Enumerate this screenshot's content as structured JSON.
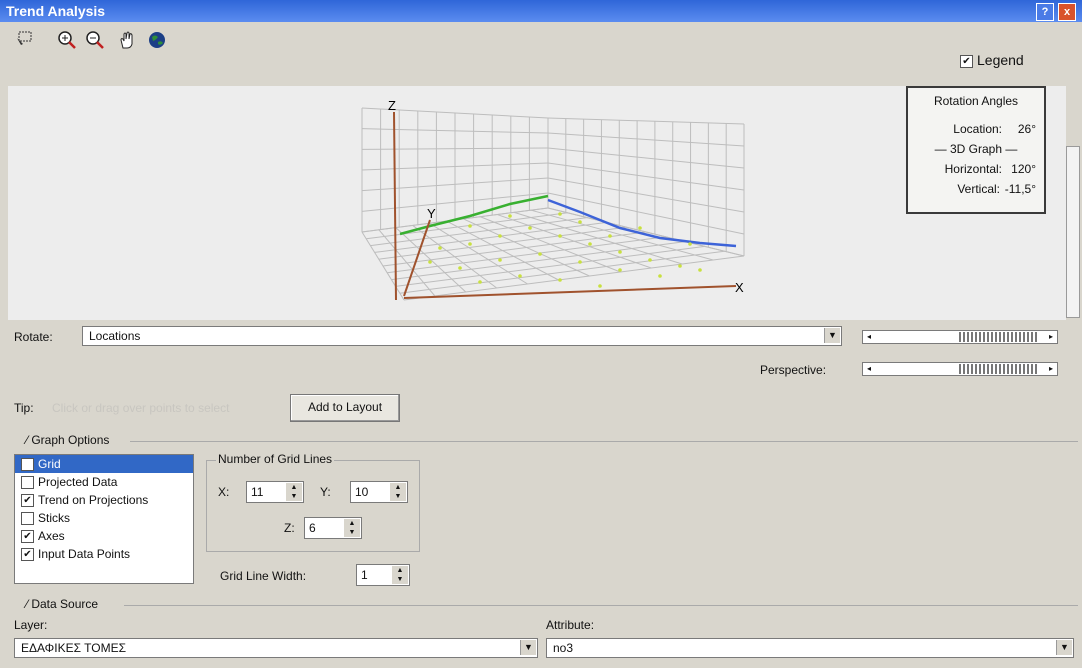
{
  "window": {
    "title": "Trend Analysis",
    "help": "?",
    "close": "x"
  },
  "toolbar": {
    "icons": [
      "select-icon",
      "zoom-in-icon",
      "zoom-out-icon",
      "pan-hand-icon",
      "globe-icon"
    ],
    "legend_label": "Legend",
    "legend_checked": true
  },
  "graph": {
    "axis_x": "X",
    "axis_y": "Y",
    "axis_z": "Z",
    "green_trend_color": "#38b030",
    "blue_trend_color": "#3d63d8",
    "axis_color": "#a0522d"
  },
  "rotation": {
    "title": "Rotation Angles",
    "location_label": "Location:",
    "location_value": "26°",
    "graph_header": "— 3D Graph —",
    "horizontal_label": "Horizontal:",
    "horizontal_value": "120°",
    "vertical_label": "Vertical:",
    "vertical_value": "-11,5°"
  },
  "rotate": {
    "label": "Rotate:",
    "value": "Locations"
  },
  "perspective": {
    "label": "Perspective:"
  },
  "tip": {
    "label": "Tip:",
    "text": "Click or drag over points to select",
    "button": "Add to Layout"
  },
  "graph_options": {
    "title": "Graph Options",
    "items": [
      {
        "label": "Grid",
        "checked": true,
        "selected": true
      },
      {
        "label": "Projected Data",
        "checked": false,
        "selected": false
      },
      {
        "label": "Trend on Projections",
        "checked": true,
        "selected": false
      },
      {
        "label": "Sticks",
        "checked": false,
        "selected": false
      },
      {
        "label": "Axes",
        "checked": true,
        "selected": false
      },
      {
        "label": "Input Data Points",
        "checked": true,
        "selected": false
      }
    ],
    "grid_lines_title": "Number of Grid Lines",
    "x_label": "X:",
    "x_value": "11",
    "y_label": "Y:",
    "y_value": "10",
    "z_label": "Z:",
    "z_value": "6",
    "grid_width_label": "Grid Line Width:",
    "grid_width_value": "1"
  },
  "data_source": {
    "title": "Data Source",
    "layer_label": "Layer:",
    "layer_value": "ΕΔΑΦΙΚΕΣ ΤΟΜΕΣ",
    "attribute_label": "Attribute:",
    "attribute_value": "no3"
  }
}
